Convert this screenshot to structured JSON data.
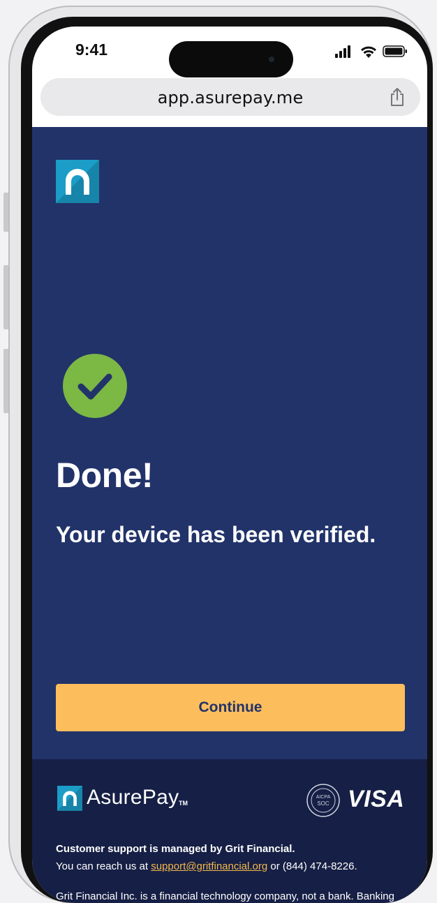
{
  "status_bar": {
    "time": "9:41"
  },
  "browser": {
    "url": "app.asurepay.me"
  },
  "page": {
    "heading": "Done!",
    "message": "Your device has been verified.",
    "continue_label": "Continue"
  },
  "footer": {
    "brand_name": "AsurePay",
    "trademark": "TM",
    "aicpa_label": "AICPA",
    "soc_label": "SOC",
    "card_brand": "VISA",
    "support_title": "Customer support is managed by Grit Financial.",
    "support_prefix": "You can reach us at ",
    "support_email": "support@gritfinancial.org",
    "support_suffix": " or (844) 474-8226.",
    "disclaimer": "Grit Financial Inc. is a financial technology company, not a bank. Banking"
  },
  "colors": {
    "primary_blue": "#22336a",
    "footer_blue": "#161f45",
    "accent_yellow": "#fcbe5c",
    "success_green": "#7cb844",
    "logo_teal": "#1b9dc7"
  }
}
